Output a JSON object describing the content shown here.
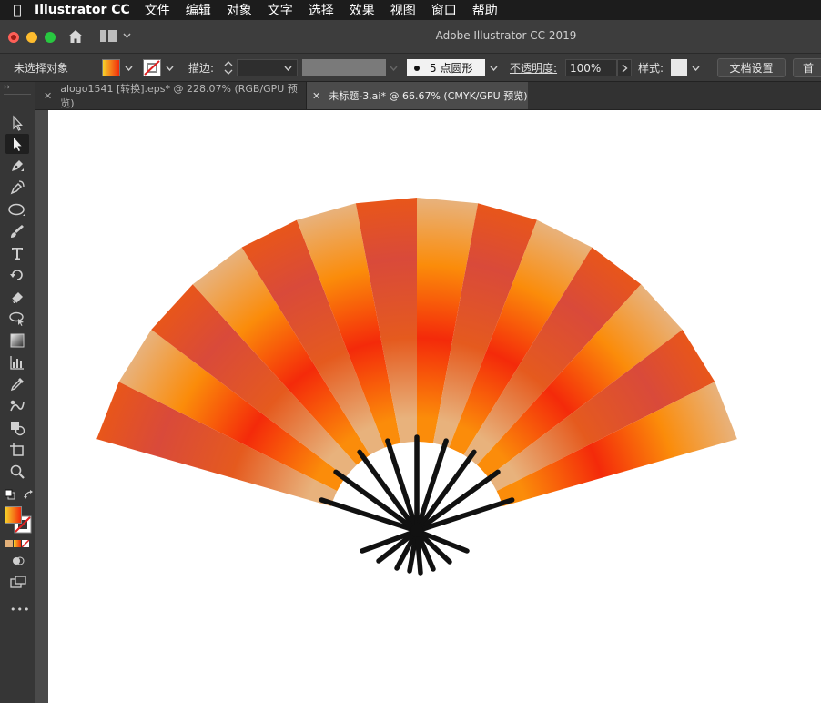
{
  "menubar": {
    "app_name": "Illustrator CC",
    "items": [
      "文件",
      "编辑",
      "对象",
      "文字",
      "选择",
      "效果",
      "视图",
      "窗口",
      "帮助"
    ]
  },
  "window": {
    "title": "Adobe Illustrator CC 2019"
  },
  "controlbar": {
    "selection_label": "未选择对象",
    "stroke_label": "描边:",
    "brush_label": "5 点圆形",
    "opacity_label": "不透明度:",
    "opacity_value": "100%",
    "style_label": "样式:",
    "doc_setup_label": "文档设置",
    "prefs_label": "首"
  },
  "tabs": [
    {
      "title": "alogo1541 [转换].eps* @ 228.07% (RGB/GPU 预览)",
      "active": false
    },
    {
      "title": "未标题-3.ai* @ 66.67% (CMYK/GPU 预览)",
      "active": true
    }
  ],
  "toolbar": {
    "collapse_glyph": "››",
    "more_glyph": "•••"
  },
  "colors": {
    "fan_light": "#e4b37a",
    "fan_orange": "#fb8c0a",
    "fan_red": "#f42a0a",
    "fan_deep": "#e55a1e",
    "rib": "#111111"
  }
}
